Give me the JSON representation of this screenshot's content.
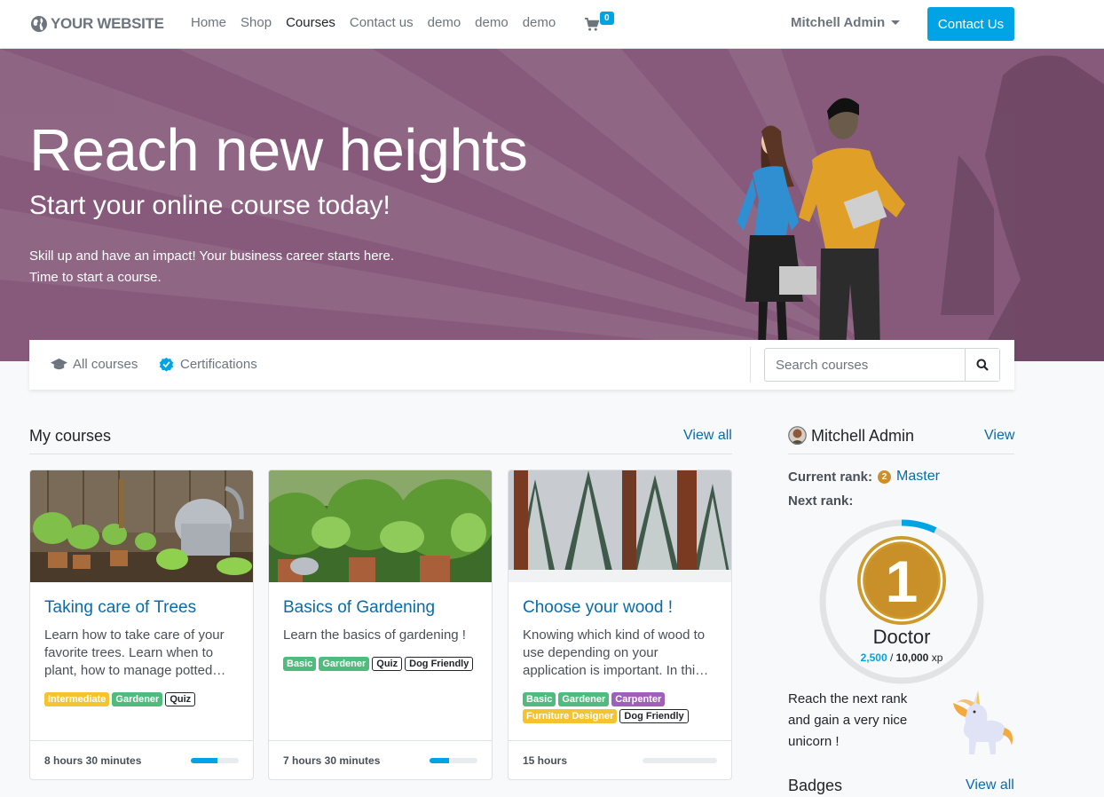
{
  "navbar": {
    "logo_text": "YOUR WEBSITE",
    "links": [
      "Home",
      "Shop",
      "Courses",
      "Contact us",
      "demo",
      "demo",
      "demo"
    ],
    "active_link": "Courses",
    "cart_count": "0",
    "user_name": "Mitchell Admin",
    "contact_button": "Contact Us"
  },
  "hero": {
    "title": "Reach new heights",
    "subtitle": "Start your online course today!",
    "text_line1": "Skill up and have an impact! Your business career starts here.",
    "text_line2": "Time to start a course."
  },
  "filters": {
    "all_courses": "All courses",
    "certifications": "Certifications",
    "search_placeholder": "Search courses"
  },
  "my_courses": {
    "title": "My courses",
    "view_all": "View all",
    "courses": [
      {
        "title": "Taking care of Trees",
        "description": "Learn how to take care of your favorite trees. Learn when to plant, how to manage potted…",
        "tags": [
          {
            "label": "Intermediate",
            "style": "yellow"
          },
          {
            "label": "Gardener",
            "style": "green"
          },
          {
            "label": "Quiz",
            "style": "outline"
          }
        ],
        "duration": "8 hours 30 minutes",
        "progress": 0.55
      },
      {
        "title": "Basics of Gardening",
        "description": "Learn the basics of gardening !",
        "tags": [
          {
            "label": "Basic",
            "style": "green"
          },
          {
            "label": "Gardener",
            "style": "green"
          },
          {
            "label": "Quiz",
            "style": "outline"
          },
          {
            "label": "Dog Friendly",
            "style": "outline"
          }
        ],
        "duration": "7 hours 30 minutes",
        "progress": 0.4
      },
      {
        "title": "Choose your wood !",
        "description": "Knowing which kind of wood to use depending on your application is important. In thi…",
        "tags": [
          {
            "label": "Basic",
            "style": "green"
          },
          {
            "label": "Gardener",
            "style": "green"
          },
          {
            "label": "Carpenter",
            "style": "purple"
          },
          {
            "label": "Furniture Designer",
            "style": "yellow"
          },
          {
            "label": "Dog Friendly",
            "style": "outline"
          }
        ],
        "duration": "15 hours",
        "progress": 0
      }
    ]
  },
  "profile": {
    "name": "Mitchell Admin",
    "view": "View",
    "current_rank_label": "Current rank:",
    "current_rank_medal": "2",
    "current_rank": "Master",
    "next_rank_label": "Next rank:",
    "next_rank_number": "1",
    "next_rank_name": "Doctor",
    "xp_current": "2,500",
    "xp_separator": " / ",
    "xp_max": "10,000",
    "xp_unit": " xp",
    "xp_progress": 0.07,
    "next_rank_description": "Reach the next rank and gain a very nice unicorn !"
  },
  "badges": {
    "title": "Badges",
    "view_all": "View all"
  },
  "colors": {
    "brand_purple": "#875a7b",
    "primary_blue": "#00a4e4",
    "link_blue": "#0a6ba7",
    "rank_gold": "#cd9a2b"
  }
}
